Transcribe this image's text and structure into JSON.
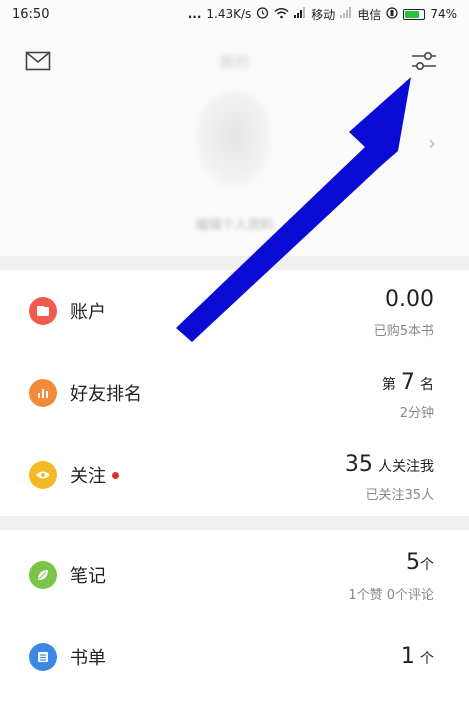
{
  "status_bar": {
    "time": "16:50",
    "dots": "...",
    "speed": "1.43K/s",
    "carrier1": "移动",
    "carrier2": "电信",
    "battery": "74%"
  },
  "header": {
    "title": "我的",
    "subtitle": "编辑个人资料",
    "icons": [
      "mail-icon",
      "settings-sliders-icon",
      "chevron-right-icon"
    ]
  },
  "rows": [
    {
      "label": "账户",
      "value_main": "0.00",
      "value_sub": "已购5本书",
      "icon": "wallet-icon",
      "color": "#f15b4f"
    },
    {
      "label": "好友排名",
      "value_prefix": "第",
      "value_num": "7",
      "value_suffix": "名",
      "value_sub": "2分钟",
      "icon": "bar-chart-icon",
      "color": "#f28b39"
    },
    {
      "label": "关注",
      "value_num": "35",
      "value_suffix": "人关注我",
      "value_sub": "已关注35人",
      "icon": "eye-icon",
      "color": "#f2bb24",
      "has_dot": true
    },
    {
      "label": "笔记",
      "value_num": "5",
      "value_suffix": "个",
      "value_sub": "1个赞 0个评论",
      "icon": "leaf-icon",
      "color": "#79c449"
    },
    {
      "label": "书单",
      "value_num": "1",
      "value_suffix": "个",
      "icon": "list-icon",
      "color": "#3e88e5"
    }
  ],
  "annotation": {
    "arrow_color": "#0b0bd6"
  }
}
